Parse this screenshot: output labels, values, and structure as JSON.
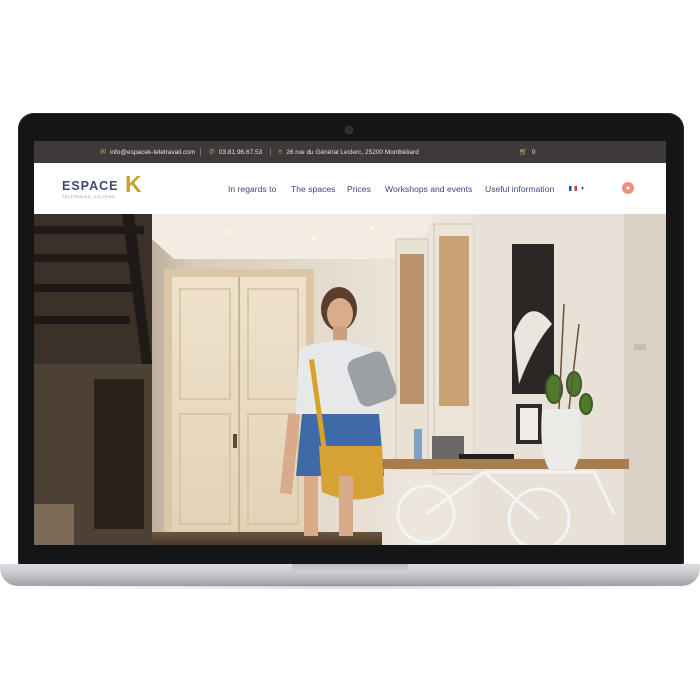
{
  "topbar": {
    "email": "info@espacek-teletravail.com",
    "phone": "03.81.96.67.53",
    "address": "26 rue du Général Leclerc, 25200 Montbéliard",
    "cart_count": "0",
    "icons": [
      "envelope-icon",
      "phone-icon",
      "map-pin-icon",
      "cart-icon"
    ]
  },
  "logo": {
    "word": "ESPACE",
    "letter": "K",
    "tagline": "TÉLÉTRAVAIL COLIVING",
    "colors": {
      "word": "#3c4a7a",
      "letter": "#c9a233"
    }
  },
  "nav": {
    "items": [
      {
        "label": "In regards to"
      },
      {
        "label": "The spaces"
      },
      {
        "label": "Prices"
      },
      {
        "label": "Workshops and events"
      },
      {
        "label": "Useful information"
      }
    ],
    "language_icon": "french-flag-icon",
    "user_icon": "user-icon"
  },
  "hero": {
    "image": "photo-woman-in-hallway-with-bicycle-desk"
  },
  "colors": {
    "topbar_bg": "#3f3a3a",
    "accent_gold": "#c9a96a",
    "nav_text": "#3c4a7a",
    "user_button": "#f0907c"
  }
}
